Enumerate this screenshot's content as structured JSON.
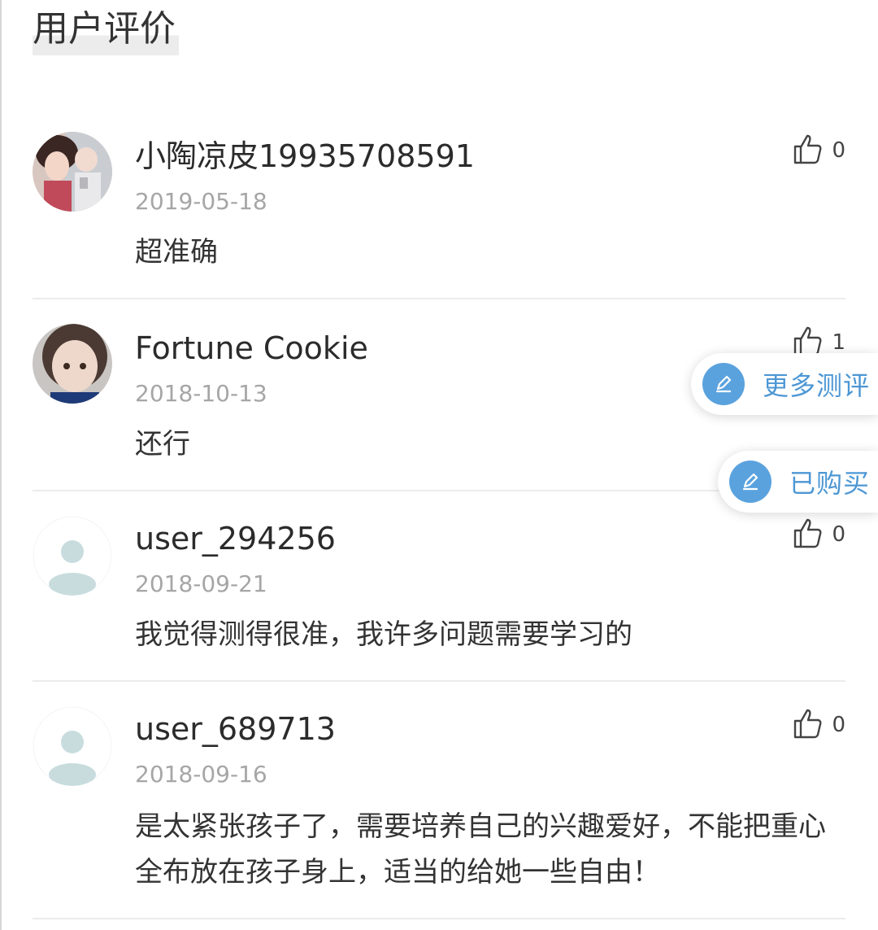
{
  "section": {
    "title": "用户评价"
  },
  "icons": {
    "like": "thumbs-up-icon",
    "pencil": "pencil-icon"
  },
  "colors": {
    "accent": "#5aa2de",
    "accent_text": "#4d97d4",
    "date": "#a6a6a6",
    "divider": "#ececec"
  },
  "reviews": [
    {
      "username": "小陶凉皮19935708591",
      "date": "2019-05-18",
      "content": "超准确",
      "likes": "0",
      "avatar": "photo-woman-child"
    },
    {
      "username": "Fortune Cookie",
      "date": "2018-10-13",
      "content": "还行",
      "likes": "1",
      "avatar": "photo-child"
    },
    {
      "username": "user_294256",
      "date": "2018-09-21",
      "content": "我觉得测得很准，我许多问题需要学习的",
      "likes": "0",
      "avatar": "default-avatar"
    },
    {
      "username": "user_689713",
      "date": "2018-09-16",
      "content": "是太紧张孩子了，需要培养自己的兴趣爱好，不能把重心全布放在孩子身上，适当的给她一些自由！",
      "likes": "0",
      "avatar": "default-avatar"
    }
  ],
  "floating": {
    "more_reviews": "更多测评",
    "purchased": "已购买"
  }
}
